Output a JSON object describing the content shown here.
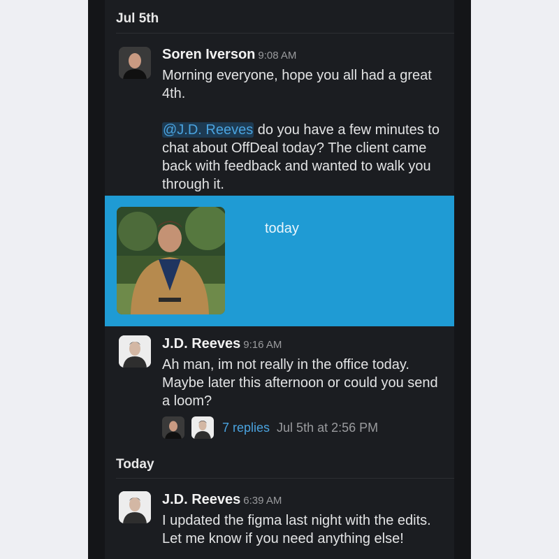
{
  "dividers": {
    "first": "Jul 5th",
    "second": "Today"
  },
  "messages": [
    {
      "author": "Soren Iverson",
      "time": "9:08 AM",
      "line1": "Morning everyone, hope you all had a great 4th.",
      "mention": "@J.D. Reeves",
      "line2": " do you have a few minutes to chat about OffDeal today? The client came back with feedback and wanted to walk you through it."
    },
    {
      "author": "J.D. Reeves",
      "time": "9:16 AM",
      "text": "Ah man, im not really in the office today. Maybe later this afternoon or could you send a loom?"
    },
    {
      "author": "J.D. Reeves",
      "time": "6:39 AM",
      "text": "I updated the figma last night with the edits. Let me know if you need anything else!"
    }
  ],
  "highlight": {
    "caption": "today"
  },
  "thread": {
    "replies": "7 replies",
    "last_reply": "Jul 5th at 2:56 PM"
  },
  "colors": {
    "highlight": "#1f9bd4",
    "link": "#4aa3df",
    "background": "#1b1d21"
  }
}
